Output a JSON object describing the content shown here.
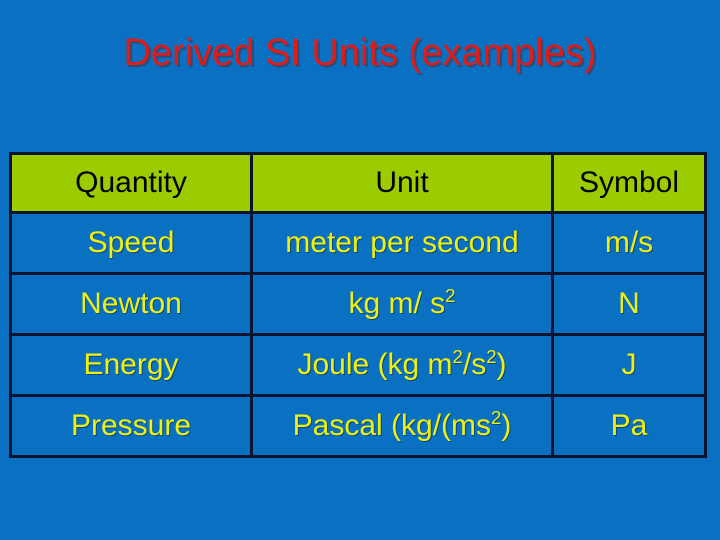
{
  "slide": {
    "title": "Derived SI Units (examples)",
    "title_color": "#e01b18",
    "background_color": "#0a71c2"
  },
  "table": {
    "header_background": "#9ccc00",
    "header_text_color": "#000000",
    "body_text_color": "#f0f010",
    "border_color": "#0d1430",
    "columns": [
      {
        "key": "quantity",
        "label": "Quantity"
      },
      {
        "key": "unit",
        "label": "Unit"
      },
      {
        "key": "symbol",
        "label": "Symbol"
      }
    ],
    "rows": [
      {
        "quantity": "Speed",
        "unit_parts": [
          {
            "text": "meter per second",
            "sup": false
          }
        ],
        "unit_plain": "meter per second",
        "symbol": "m/s"
      },
      {
        "quantity": "Newton",
        "unit_parts": [
          {
            "text": "kg m/ s",
            "sup": false
          },
          {
            "text": "2",
            "sup": true
          }
        ],
        "unit_plain": "kg m/ s2",
        "symbol": "N"
      },
      {
        "quantity": "Energy",
        "unit_parts": [
          {
            "text": "Joule (kg m",
            "sup": false
          },
          {
            "text": "2",
            "sup": true
          },
          {
            "text": "/s",
            "sup": false
          },
          {
            "text": "2",
            "sup": true
          },
          {
            "text": ")",
            "sup": false
          }
        ],
        "unit_plain": "Joule (kg m2/s2)",
        "symbol": "J"
      },
      {
        "quantity": "Pressure",
        "unit_parts": [
          {
            "text": "Pascal (kg/(ms",
            "sup": false
          },
          {
            "text": "2",
            "sup": true
          },
          {
            "text": ")",
            "sup": false
          }
        ],
        "unit_plain": "Pascal (kg/(ms2)",
        "symbol": "Pa"
      }
    ]
  }
}
